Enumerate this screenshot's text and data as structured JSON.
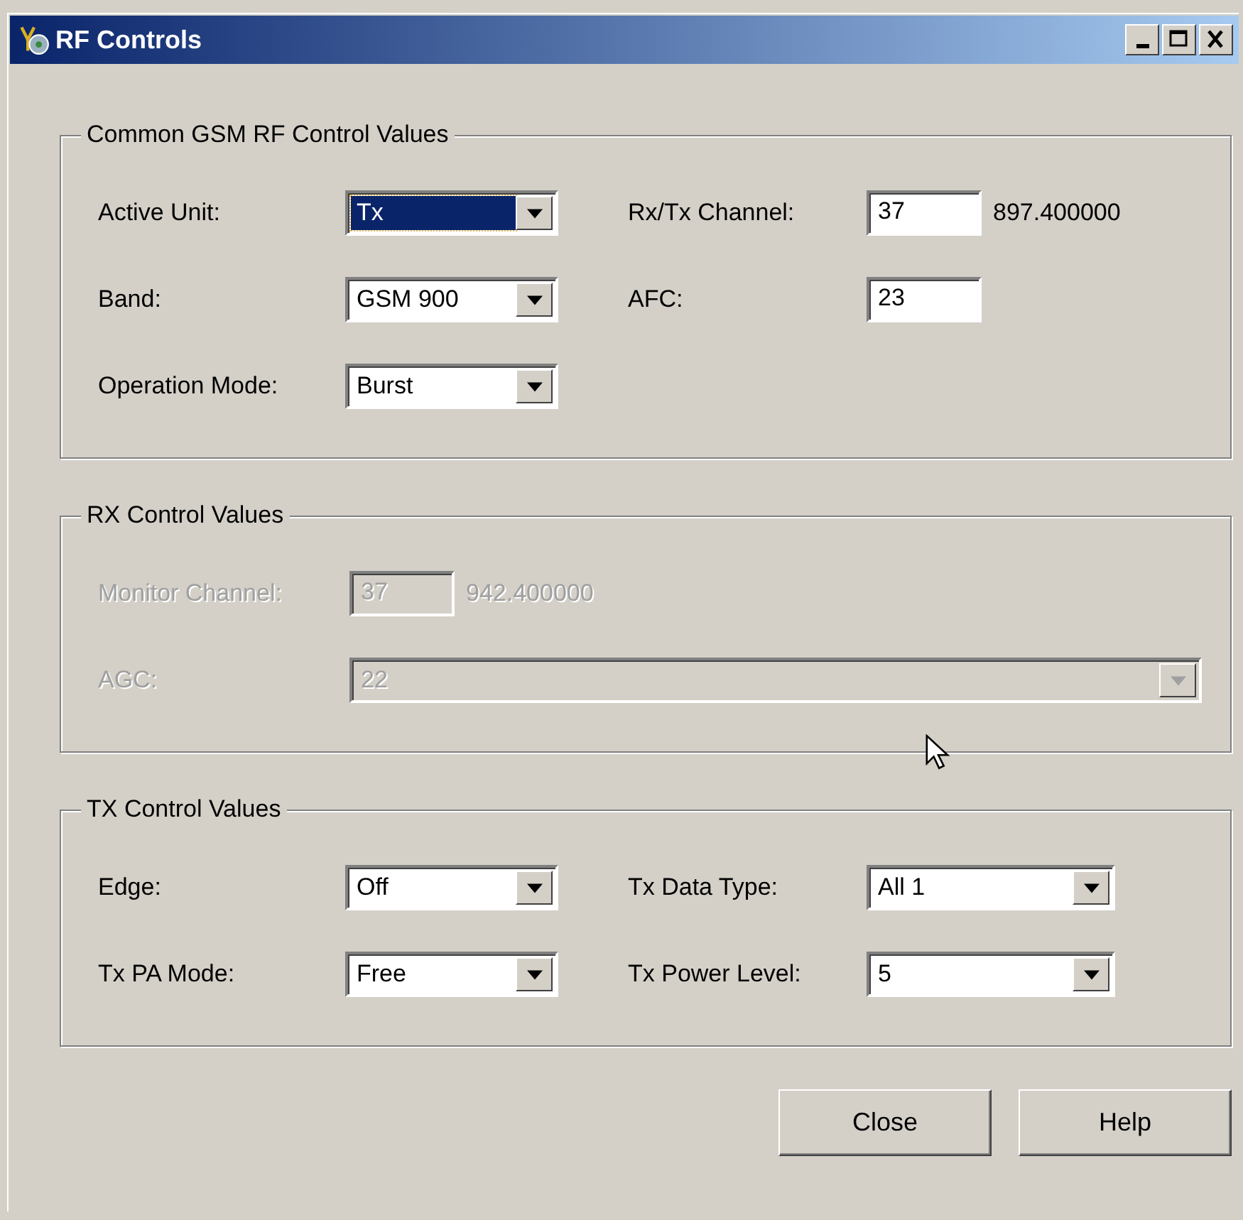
{
  "window": {
    "title": "RF Controls"
  },
  "groups": [
    {
      "title": "Common GSM RF Control Values",
      "disabled": false,
      "rows": [
        [
          {
            "kind": "combo",
            "label": "Active Unit:",
            "value": "Tx",
            "focused": true
          },
          {
            "kind": "text",
            "label": "Rx/Tx Channel:",
            "value": "37",
            "reading": "897.400000"
          }
        ],
        [
          {
            "kind": "combo",
            "label": "Band:",
            "value": "GSM 900",
            "focused": false
          },
          {
            "kind": "text",
            "label": "AFC:",
            "value": "23"
          }
        ],
        [
          {
            "kind": "combo",
            "label": "Operation Mode:",
            "value": "Burst",
            "focused": false
          }
        ]
      ]
    },
    {
      "title": "RX Control Values",
      "disabled": true,
      "rows": [
        [
          {
            "kind": "text",
            "label": "Monitor Channel:",
            "value": "37",
            "reading": "942.400000"
          }
        ],
        [
          {
            "kind": "combo",
            "label": "AGC:",
            "value": "22",
            "focused": false
          }
        ]
      ]
    },
    {
      "title": "TX Control Values",
      "disabled": false,
      "rows": [
        [
          {
            "kind": "combo",
            "label": "Edge:",
            "value": "Off",
            "focused": false
          },
          {
            "kind": "combo",
            "label": "Tx Data Type:",
            "value": "All 1",
            "focused": false
          }
        ],
        [
          {
            "kind": "combo",
            "label": "Tx PA Mode:",
            "value": "Free",
            "focused": false
          },
          {
            "kind": "combo",
            "label": "Tx Power Level:",
            "value": "5",
            "focused": false
          }
        ]
      ]
    }
  ],
  "buttons": [
    "Close",
    "Help"
  ]
}
